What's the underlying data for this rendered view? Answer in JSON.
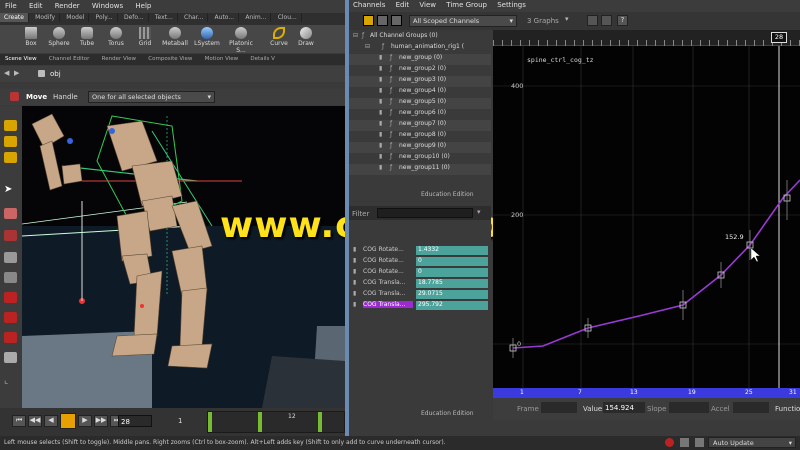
{
  "menubar": {
    "items": [
      "File",
      "Edit",
      "Render",
      "Windows",
      "Help"
    ]
  },
  "shelf": {
    "tabs": [
      "Create",
      "Modify",
      "Model",
      "Poly...",
      "Defo...",
      "Text...",
      "Char...",
      "Auto...",
      "Anim...",
      "Clou..."
    ],
    "tools": [
      "Box",
      "Sphere",
      "Tube",
      "Torus",
      "Grid",
      "Metaball",
      "LSystem",
      "Platonic S...",
      "Curve",
      "Draw"
    ]
  },
  "pane_tabs": [
    "Scene View",
    "Channel Editor",
    "Render View",
    "Composite View",
    "Motion View",
    "Details V"
  ],
  "pathbar": {
    "path": "obj"
  },
  "handle": {
    "mode": "Move",
    "label": "Handle",
    "dropdown": "One for all selected objects"
  },
  "playbar": {
    "frame": "28",
    "start": "1",
    "marker": "12"
  },
  "statusbar": {
    "text": "Left mouse selects (Shift to toggle). Middle pans. Right zooms (Ctrl to box-zoom). Alt+Left adds key (Shift to only add to curve underneath cursor).",
    "auto_update": "Auto Update"
  },
  "channel_editor": {
    "menu": [
      "Channels",
      "Edit",
      "View",
      "Time Group",
      "Settings"
    ],
    "scope": "All Scoped Channels",
    "graphs": "3 Graphs",
    "tree": [
      "All Channel Groups (0)",
      "human_animation_rig1 (",
      "new_group (0)",
      "new_group2 (0)",
      "new_group3 (0)",
      "new_group4 (0)",
      "new_group5 (0)",
      "new_group6 (0)",
      "new_group7 (0)",
      "new_group8 (0)",
      "new_group9 (0)",
      "new_group10 (0)",
      "new_group11 (0)"
    ],
    "edition_label": "Education Edition",
    "filter_label": "Filter",
    "channels": [
      {
        "name": "COG Rotate...",
        "value": "1.4332"
      },
      {
        "name": "COG Rotate...",
        "value": "0"
      },
      {
        "name": "COG Rotate...",
        "value": "0"
      },
      {
        "name": "COG Transla...",
        "value": "18.7785"
      },
      {
        "name": "COG Transla...",
        "value": "29.0715"
      },
      {
        "name": "COG Transla...",
        "value": "295.792"
      }
    ],
    "edition_label2": "Education Edition"
  },
  "graph": {
    "channel_name": "spine_ctrl_cog_tz",
    "current_frame": "28",
    "y_ticks": [
      "400",
      "200",
      "0"
    ],
    "x_ticks": [
      "1",
      "7",
      "13",
      "19",
      "25",
      "31"
    ],
    "key_label": "152.9",
    "fields": {
      "frame_label": "Frame",
      "value_label": "Value",
      "value": "154.924",
      "slope_label": "Slope",
      "accel_label": "Accel",
      "function_label": "Functio"
    }
  },
  "watermark": "www.cgtsj.com",
  "colors": {
    "accent_purple": "#9b2bd0",
    "channel_teal": "#4ba39b",
    "graph_curve": "#9a3ad4",
    "timeline_blue": "#3a3adf"
  }
}
